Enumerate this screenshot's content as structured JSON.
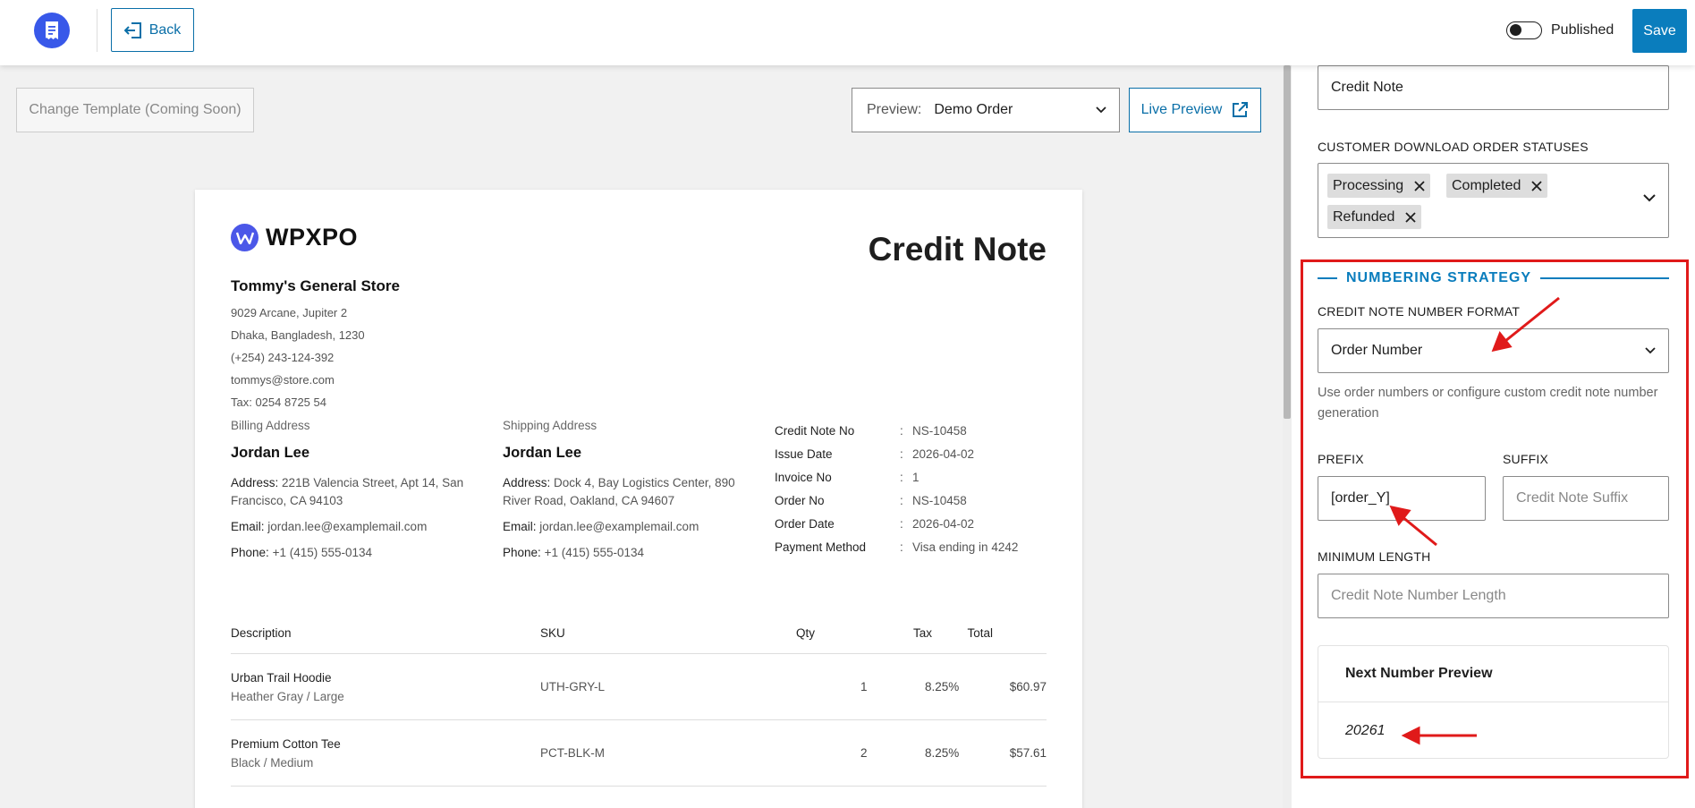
{
  "header": {
    "back_label": "Back",
    "published_label": "Published",
    "save_label": "Save"
  },
  "toolbar": {
    "change_template_label": "Change Template (Coming Soon)",
    "preview_label": "Preview:",
    "preview_value": "Demo Order",
    "live_preview_label": "Live Preview"
  },
  "document": {
    "brand_name": "WPXPO",
    "title": "Credit Note",
    "store_name": "Tommy's General Store",
    "store_lines": [
      "9029 Arcane, Jupiter 2",
      "Dhaka, Bangladesh, 1230",
      "(+254) 243-124-392",
      "tommys@store.com",
      "Tax: 0254 8725 54"
    ],
    "billing": {
      "heading": "Billing Address",
      "name": "Jordan Lee",
      "address_label": "Address:",
      "address": "221B Valencia Street, Apt 14, San Francisco, CA 94103",
      "email_label": "Email:",
      "email": "jordan.lee@examplemail.com",
      "phone_label": "Phone:",
      "phone": "+1 (415) 555-0134"
    },
    "shipping": {
      "heading": "Shipping Address",
      "name": "Jordan Lee",
      "address_label": "Address:",
      "address": "Dock 4, Bay Logistics Center, 890 River Road, Oakland, CA 94607",
      "email_label": "Email:",
      "email": "jordan.lee@examplemail.com",
      "phone_label": "Phone:",
      "phone": "+1 (415) 555-0134"
    },
    "meta": [
      {
        "k": "Credit Note No",
        "v": "NS-10458"
      },
      {
        "k": "Issue Date",
        "v": "2026-04-02"
      },
      {
        "k": "Invoice No",
        "v": "1"
      },
      {
        "k": "Order No",
        "v": "NS-10458"
      },
      {
        "k": "Order Date",
        "v": "2026-04-02"
      },
      {
        "k": "Payment Method",
        "v": "Visa ending in 4242"
      }
    ],
    "meta_separator": ":",
    "columns": {
      "desc": "Description",
      "sku": "SKU",
      "qty": "Qty",
      "tax": "Tax",
      "total": "Total"
    },
    "items": [
      {
        "name": "Urban Trail Hoodie",
        "variant": "Heather Gray / Large",
        "sku": "UTH-GRY-L",
        "qty": "1",
        "tax": "8.25%",
        "total": "$60.97"
      },
      {
        "name": "Premium Cotton Tee",
        "variant": "Black / Medium",
        "sku": "PCT-BLK-M",
        "qty": "2",
        "tax": "8.25%",
        "total": "$57.61"
      }
    ]
  },
  "sidebar": {
    "title_value": "Credit Note",
    "statuses_label": "CUSTOMER DOWNLOAD ORDER STATUSES",
    "statuses": [
      "Processing",
      "Completed",
      "Refunded"
    ],
    "numbering_title": "NUMBERING STRATEGY",
    "format_label": "CREDIT NOTE NUMBER FORMAT",
    "format_value": "Order Number",
    "format_help": "Use order numbers or configure custom credit note number generation",
    "prefix_label": "PREFIX",
    "prefix_value": "[order_Y]",
    "suffix_label": "SUFFIX",
    "suffix_placeholder": "Credit Note Suffix",
    "min_length_label": "MINIMUM LENGTH",
    "min_length_placeholder": "Credit Note Number Length",
    "next_preview_label": "Next Number Preview",
    "next_preview_value": "20261"
  },
  "colors": {
    "accent": "#0a7dbd",
    "highlight": "#e01a1a",
    "logo": "#3858e9"
  },
  "icons": [
    "receipt-icon",
    "back-arrow-icon",
    "chevron-down-icon",
    "external-link-icon",
    "close-icon",
    "wpxpo-logo-icon"
  ]
}
